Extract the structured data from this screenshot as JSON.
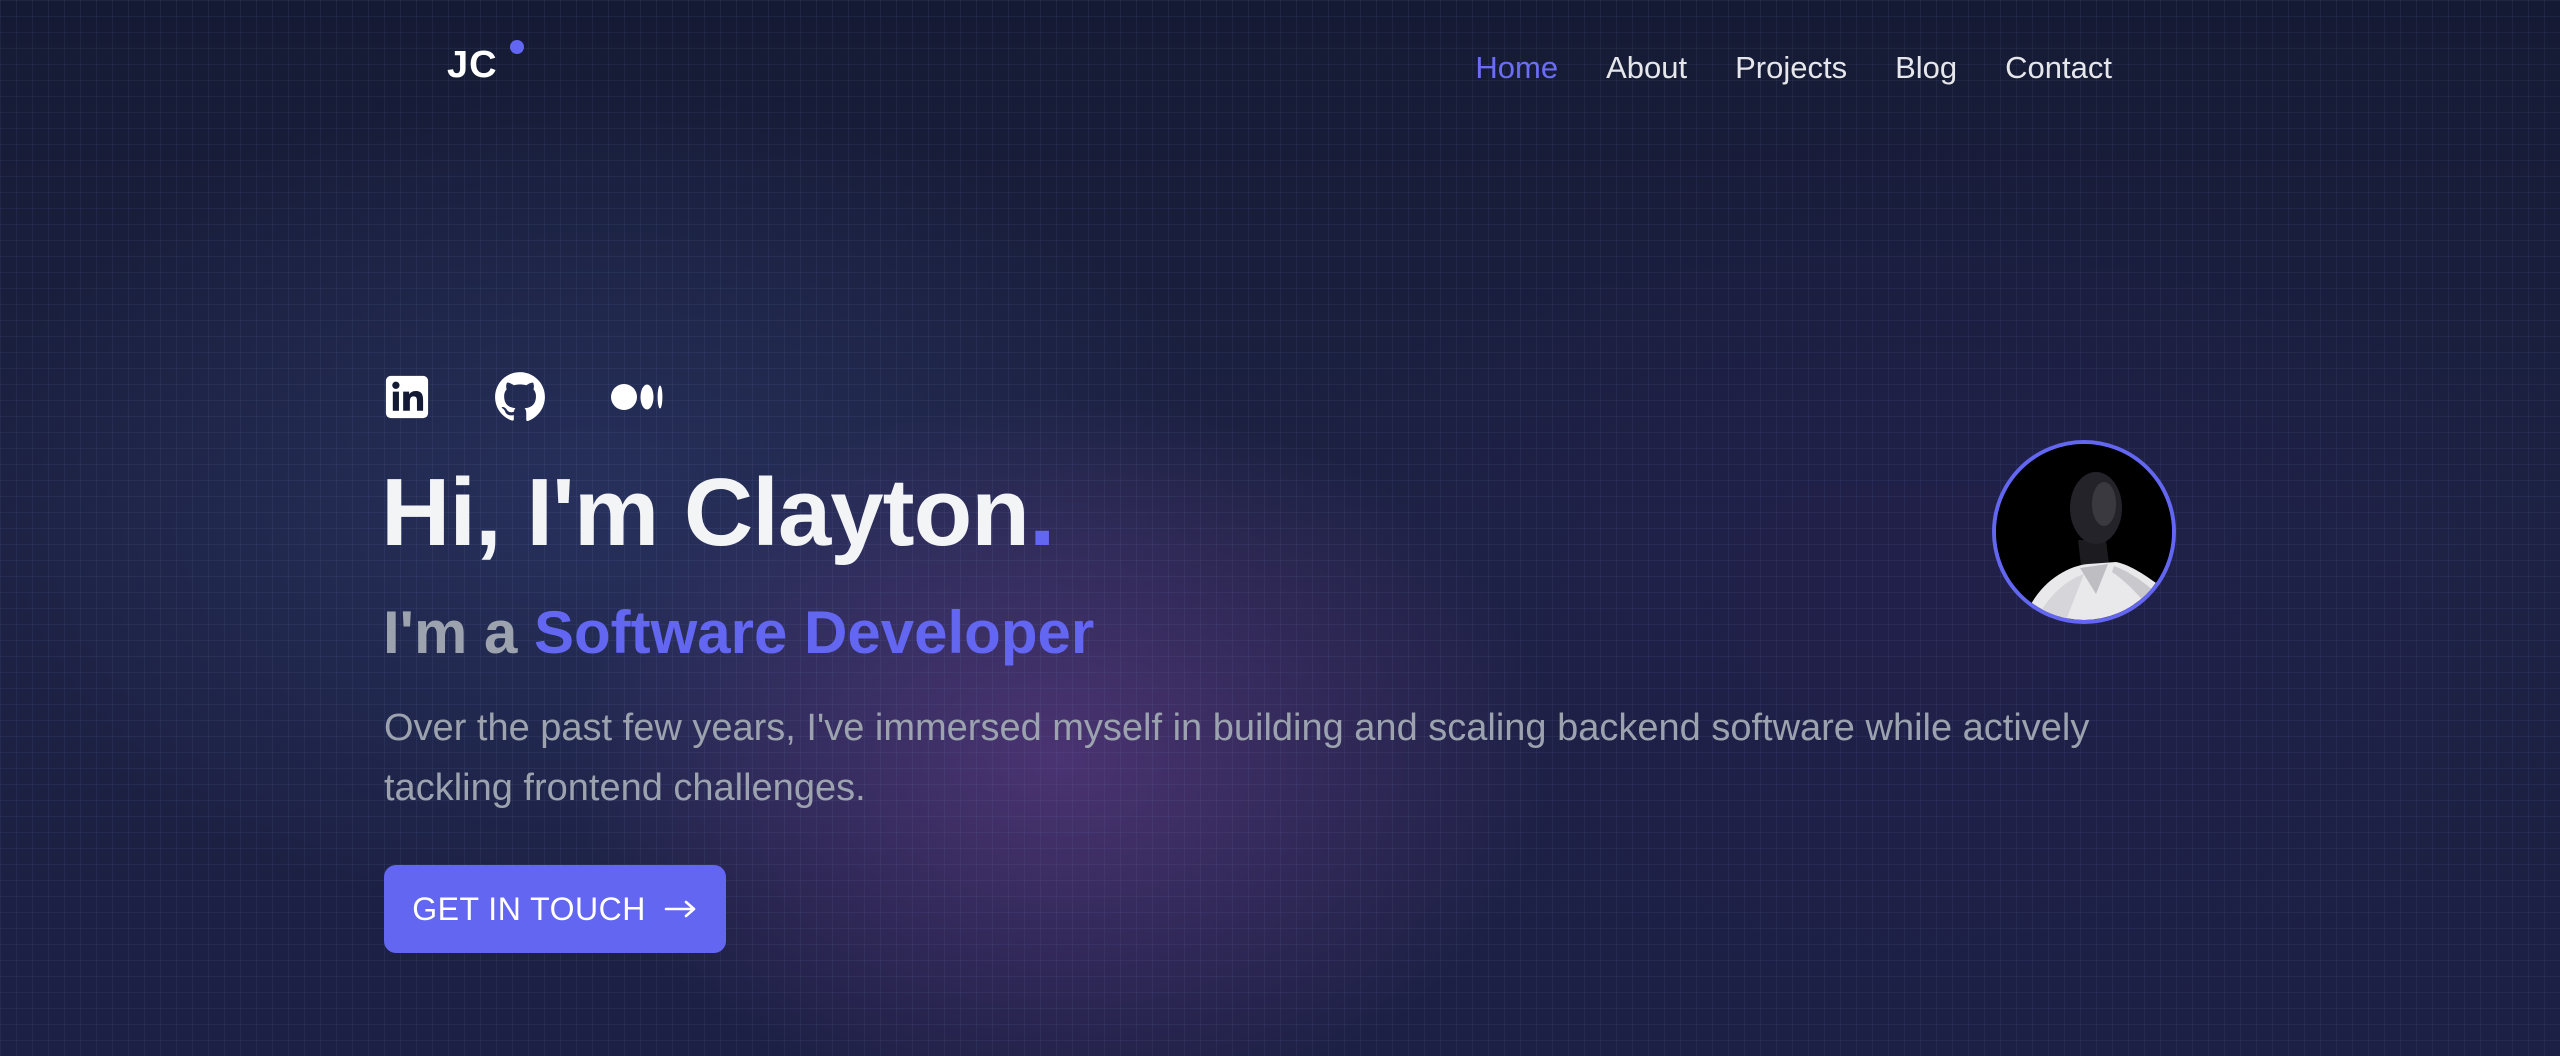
{
  "logo": {
    "text": "JC"
  },
  "nav": {
    "items": [
      {
        "label": "Home",
        "active": true
      },
      {
        "label": "About",
        "active": false
      },
      {
        "label": "Projects",
        "active": false
      },
      {
        "label": "Blog",
        "active": false
      },
      {
        "label": "Contact",
        "active": false
      }
    ]
  },
  "socials": {
    "items": [
      {
        "icon": "linkedin-icon"
      },
      {
        "icon": "github-icon"
      },
      {
        "icon": "medium-icon"
      }
    ]
  },
  "hero": {
    "greeting": "Hi, I'm Clayton",
    "greeting_dot": ".",
    "role_prefix": "I'm a",
    "role": "Software Developer",
    "description": "Over the past few years, I've immersed myself in building and scaling backend software while actively tackling frontend challenges.",
    "cta_label": "GET IN TOUCH"
  },
  "colors": {
    "accent": "#6366f1",
    "background": "#141a33",
    "text_muted": "#9ca3af"
  }
}
